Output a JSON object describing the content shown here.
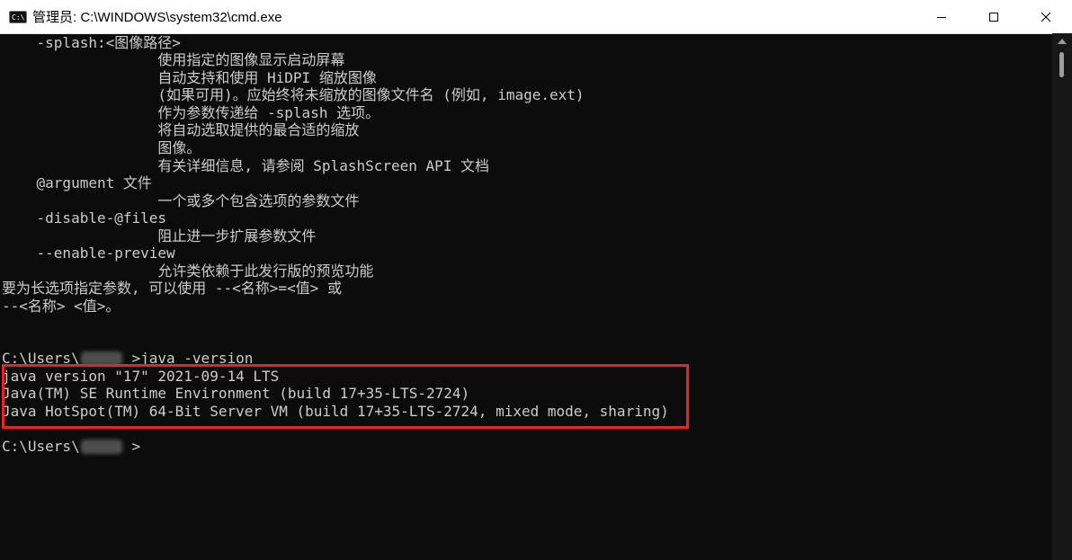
{
  "window": {
    "title": "管理员: C:\\WINDOWS\\system32\\cmd.exe",
    "app_icon_text": "C:\\",
    "icons": {
      "minimize": "minimize-icon",
      "maximize": "maximize-icon",
      "close": "close-icon"
    }
  },
  "console": {
    "lines": [
      "    -splash:<图像路径>",
      "                  使用指定的图像显示启动屏幕",
      "                  自动支持和使用 HiDPI 缩放图像",
      "                  (如果可用)。应始终将未缩放的图像文件名 (例如, image.ext)",
      "                  作为参数传递给 -splash 选项。",
      "                  将自动选取提供的最合适的缩放",
      "                  图像。",
      "                  有关详细信息, 请参阅 SplashScreen API 文档",
      "    @argument 文件",
      "                  一个或多个包含选项的参数文件",
      "    -disable-@files",
      "                  阻止进一步扩展参数文件",
      "    --enable-preview",
      "                  允许类依赖于此发行版的预览功能",
      "要为长选项指定参数, 可以使用 --<名称>=<值> 或",
      "--<名称> <值>。",
      "",
      "",
      "C:\\Users\\      >java -version",
      "java version \"17\" 2021-09-14 LTS",
      "Java(TM) SE Runtime Environment (build 17+35-LTS-2724)",
      "Java HotSpot(TM) 64-Bit Server VM (build 17+35-LTS-2724, mixed mode, sharing)",
      "",
      "C:\\Users\\      >"
    ]
  },
  "colors": {
    "background": "#0c0c0c",
    "text": "#cccccc",
    "highlight": "#e52424"
  }
}
